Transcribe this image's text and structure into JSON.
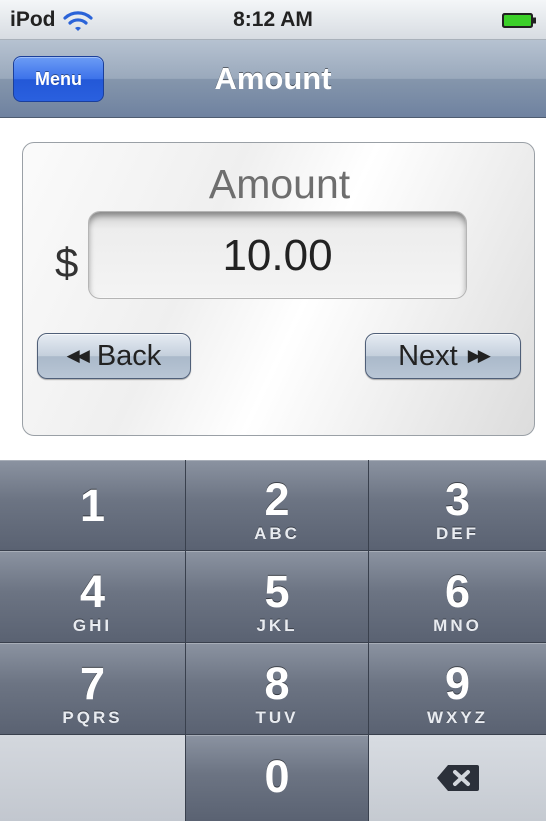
{
  "status_bar": {
    "carrier": "iPod",
    "time": "8:12 AM",
    "wifi_icon": "wifi-icon",
    "battery_icon": "battery-charging-icon",
    "battery_color": "#3cd02a"
  },
  "nav_bar": {
    "menu_label": "Menu",
    "title": "Amount",
    "menu_color": "#2f66e0"
  },
  "panel": {
    "title": "Amount",
    "currency_symbol": "$",
    "amount_value": "10.00",
    "back_label": "Back",
    "back_icon": "rewind-icon",
    "next_label": "Next",
    "next_icon": "fast-forward-icon"
  },
  "keypad": {
    "keys": [
      {
        "digit": "1",
        "letters": ""
      },
      {
        "digit": "2",
        "letters": "ABC"
      },
      {
        "digit": "3",
        "letters": "DEF"
      },
      {
        "digit": "4",
        "letters": "GHI"
      },
      {
        "digit": "5",
        "letters": "JKL"
      },
      {
        "digit": "6",
        "letters": "MNO"
      },
      {
        "digit": "7",
        "letters": "PQRS"
      },
      {
        "digit": "8",
        "letters": "TUV"
      },
      {
        "digit": "9",
        "letters": "WXYZ"
      },
      {
        "digit": "0",
        "letters": ""
      }
    ],
    "backspace_icon": "backspace-icon"
  }
}
